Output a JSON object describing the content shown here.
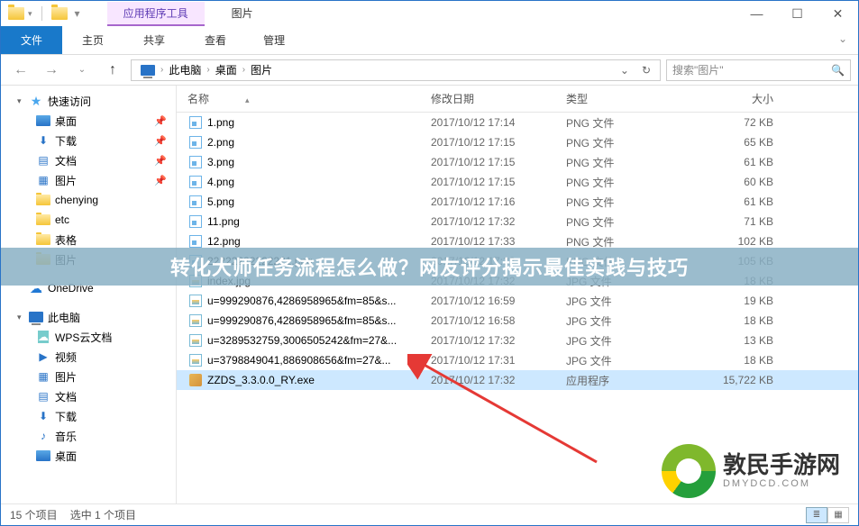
{
  "titlebar": {
    "context_tab": "应用程序工具",
    "context_plain": "图片"
  },
  "ribbon": {
    "file": "文件",
    "tabs": [
      "主页",
      "共享",
      "查看"
    ],
    "manage": "管理"
  },
  "breadcrumb": {
    "items": [
      "此电脑",
      "桌面",
      "图片"
    ]
  },
  "search": {
    "placeholder": "搜索\"图片\""
  },
  "sidebar": {
    "quick_access": "快速访问",
    "qa_items": [
      {
        "label": "桌面",
        "icon": "folder-b",
        "pinned": true
      },
      {
        "label": "下载",
        "icon": "down",
        "pinned": true
      },
      {
        "label": "文档",
        "icon": "doc",
        "pinned": true
      },
      {
        "label": "图片",
        "icon": "pic",
        "pinned": true
      },
      {
        "label": "chenying",
        "icon": "folder-y",
        "pinned": false
      },
      {
        "label": "etc",
        "icon": "folder-y",
        "pinned": false
      },
      {
        "label": "表格",
        "icon": "folder-y",
        "pinned": false
      },
      {
        "label": "图片",
        "icon": "folder-y",
        "pinned": false
      }
    ],
    "onedrive": "OneDrive",
    "this_pc": "此电脑",
    "pc_items": [
      {
        "label": "WPS云文档",
        "icon": "cloud"
      },
      {
        "label": "视频",
        "icon": "vid"
      },
      {
        "label": "图片",
        "icon": "pic"
      },
      {
        "label": "文档",
        "icon": "doc"
      },
      {
        "label": "下载",
        "icon": "down"
      },
      {
        "label": "音乐",
        "icon": "music"
      },
      {
        "label": "桌面",
        "icon": "folder-b"
      }
    ]
  },
  "columns": {
    "name": "名称",
    "date": "修改日期",
    "type": "类型",
    "size": "大小"
  },
  "files": [
    {
      "name": "1.png",
      "date": "2017/10/12 17:14",
      "type": "PNG 文件",
      "size": "72 KB",
      "icon": "png"
    },
    {
      "name": "2.png",
      "date": "2017/10/12 17:15",
      "type": "PNG 文件",
      "size": "65 KB",
      "icon": "png"
    },
    {
      "name": "3.png",
      "date": "2017/10/12 17:15",
      "type": "PNG 文件",
      "size": "61 KB",
      "icon": "png"
    },
    {
      "name": "4.png",
      "date": "2017/10/12 17:15",
      "type": "PNG 文件",
      "size": "60 KB",
      "icon": "png"
    },
    {
      "name": "5.png",
      "date": "2017/10/12 17:16",
      "type": "PNG 文件",
      "size": "61 KB",
      "icon": "png"
    },
    {
      "name": "11.png",
      "date": "2017/10/12 17:32",
      "type": "PNG 文件",
      "size": "71 KB",
      "icon": "png"
    },
    {
      "name": "12.png",
      "date": "2017/10/12 17:33",
      "type": "PNG 文件",
      "size": "102 KB",
      "icon": "png"
    },
    {
      "name": "22222222222221.png",
      "date": "2017/10/12 17:32",
      "type": "PNG 文件",
      "size": "105 KB",
      "icon": "png"
    },
    {
      "name": "index.jpg",
      "date": "2017/10/12 17:32",
      "type": "JPG 文件",
      "size": "18 KB",
      "icon": "jpg"
    },
    {
      "name": "u=999290876,4286958965&fm=85&s...",
      "date": "2017/10/12 16:59",
      "type": "JPG 文件",
      "size": "19 KB",
      "icon": "jpg"
    },
    {
      "name": "u=999290876,4286958965&fm=85&s...",
      "date": "2017/10/12 16:58",
      "type": "JPG 文件",
      "size": "18 KB",
      "icon": "jpg"
    },
    {
      "name": "u=3289532759,3006505242&fm=27&...",
      "date": "2017/10/12 17:32",
      "type": "JPG 文件",
      "size": "13 KB",
      "icon": "jpg"
    },
    {
      "name": "u=3798849041,886908656&fm=27&...",
      "date": "2017/10/12 17:31",
      "type": "JPG 文件",
      "size": "18 KB",
      "icon": "jpg"
    },
    {
      "name": "ZZDS_3.3.0.0_RY.exe",
      "date": "2017/10/12 17:32",
      "type": "应用程序",
      "size": "15,722 KB",
      "icon": "exe",
      "selected": true
    }
  ],
  "status": {
    "total": "15 个项目",
    "selected": "选中 1 个项目"
  },
  "overlay": "转化大师任务流程怎么做？网友评分揭示最佳实践与技巧",
  "logo": {
    "text": "敦民手游网",
    "sub": "DMYDCD.COM"
  }
}
